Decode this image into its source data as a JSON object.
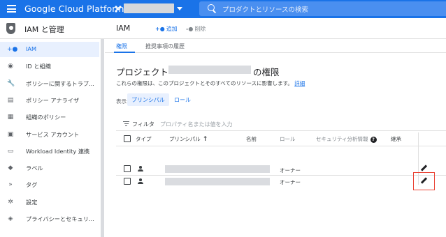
{
  "topbar": {
    "brand": "Google Cloud Platform",
    "search_placeholder": "プロダクトとリソースの検索"
  },
  "sidebar": {
    "title": "IAM と管理",
    "items": [
      {
        "label": "IAM",
        "icon": "person-add-icon",
        "glyph": "+●",
        "active": true
      },
      {
        "label": "ID と組織",
        "icon": "account-circle-icon",
        "glyph": "◉",
        "active": false
      },
      {
        "label": "ポリシーに関するトラブ...",
        "icon": "wrench-icon",
        "glyph": "🔧",
        "active": false
      },
      {
        "label": "ポリシー アナライザ",
        "icon": "policy-doc-icon",
        "glyph": "▤",
        "active": false
      },
      {
        "label": "組織のポリシー",
        "icon": "list-box-icon",
        "glyph": "▦",
        "active": false
      },
      {
        "label": "サービス アカウント",
        "icon": "service-account-icon",
        "glyph": "▣",
        "active": false
      },
      {
        "label": "Workload Identity 連携",
        "icon": "workload-identity-icon",
        "glyph": "▭",
        "active": false
      },
      {
        "label": "ラベル",
        "icon": "label-icon",
        "glyph": "◆",
        "active": false
      },
      {
        "label": "タグ",
        "icon": "tag-icon",
        "glyph": "»",
        "active": false
      },
      {
        "label": "設定",
        "icon": "settings-icon",
        "glyph": "✲",
        "active": false
      },
      {
        "label": "プライバシーとセキュリ...",
        "icon": "privacy-icon",
        "glyph": "◈",
        "active": false
      }
    ]
  },
  "header": {
    "title": "IAM",
    "add_label": "追加",
    "remove_label": "削除"
  },
  "tabs": [
    {
      "label": "権限",
      "active": true
    },
    {
      "label": "推奨事項の履歴",
      "active": false
    }
  ],
  "content": {
    "title_prefix": "プロジェクト",
    "title_suffix": "の権限",
    "description": "これらの権限は、このプロジェクトとそのすべてのリソースに影響します。",
    "details_link": "詳細",
    "view_label": "表示:",
    "view_options": [
      {
        "label": "プリンシパル",
        "active": true
      },
      {
        "label": "ロール",
        "active": false
      }
    ],
    "filter_label": "フィルタ",
    "filter_placeholder": "プロパティ名または値を入力"
  },
  "table": {
    "columns": {
      "type": "タイプ",
      "principal": "プリンシパル",
      "name": "名前",
      "role": "ロール",
      "security": "セキュリティ分析情報",
      "inherited": "継承"
    },
    "rows": [
      {
        "role": "オーナー"
      },
      {
        "role": "オーナー"
      }
    ]
  },
  "colors": {
    "accent": "#1a73e8",
    "highlight": "#ea4335"
  }
}
